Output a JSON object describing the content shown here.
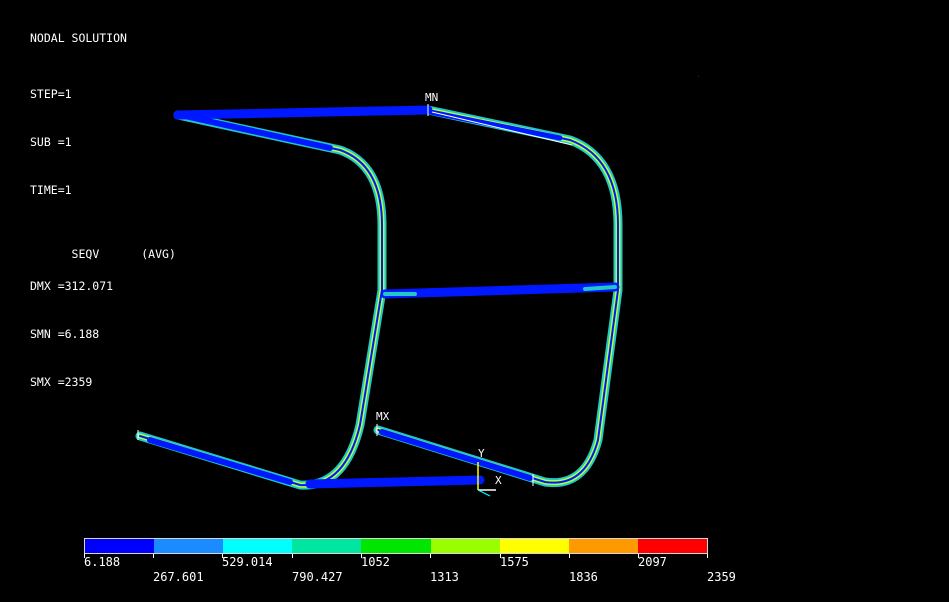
{
  "header": {
    "title": "NODAL SOLUTION",
    "lines": [
      "STEP=1",
      "SUB =1",
      "TIME=1"
    ],
    "seqv_label": "SEQV",
    "seqv_avg": "(AVG)",
    "stats": [
      "DMX =312.071",
      "SMN =6.188",
      "SMX =2359"
    ]
  },
  "labels": {
    "min_node": "MN",
    "max_node": "MX",
    "axis_y": "Y",
    "axis_x": "X"
  },
  "legend": {
    "values_top": [
      "6.188",
      "1052",
      "1575",
      "2097"
    ],
    "values_bottom": [
      "267.601",
      "529.014",
      "790.427",
      "1313",
      "1836",
      "2359"
    ],
    "colors": [
      "#0000ff",
      "#1a8cff",
      "#00ffff",
      "#00e5a0",
      "#00e600",
      "#99ff00",
      "#ffff00",
      "#ff9900",
      "#ff0000"
    ]
  },
  "palette": {
    "background": "#000000",
    "tube_blue": "#0018ff",
    "tube_mid": "#22c7c7",
    "tube_hot": "#b7ff3a"
  }
}
